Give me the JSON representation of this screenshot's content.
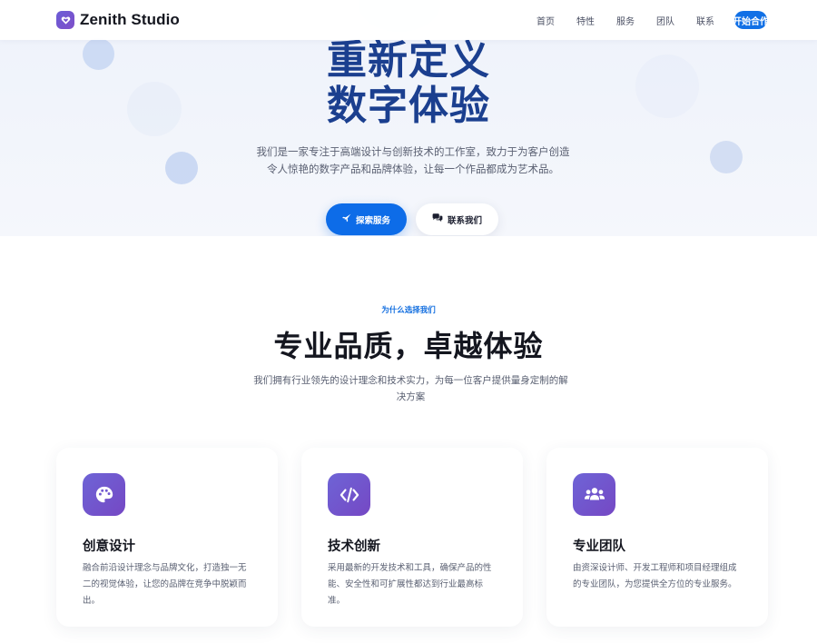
{
  "nav": {
    "brand": "Zenith Studio",
    "links": [
      "首页",
      "特性",
      "服务",
      "团队",
      "联系"
    ],
    "cta": "开始合作"
  },
  "hero": {
    "title_line1": "重新定义",
    "title_line2": "数字体验",
    "description_line1": "我们是一家专注于高端设计与创新技术的工作室，致力于为客户创造",
    "description_line2": "令人惊艳的数字产品和品牌体验，让每一个作品都成为艺术品。",
    "primary_button": "探索服务",
    "secondary_button": "联系我们"
  },
  "features": {
    "eyebrow": "为什么选择我们",
    "title": "专业品质，卓越体验",
    "description_line1": "我们拥有行业领先的设计理念和技术实力，为每一位客户提供量身定制的解",
    "description_line2": "决方案",
    "cards": [
      {
        "icon": "palette-icon",
        "title": "创意设计",
        "desc_lines": [
          "融合前沿设计理念与品牌文化，打造独一无",
          "二的视觉体验，让您的品牌在竞争中脱颖而",
          "出。"
        ]
      },
      {
        "icon": "code-icon",
        "title": "技术创新",
        "desc_lines": [
          "采用最新的开发技术和工具，确保产品的性",
          "能、安全性和可扩展性都达到行业最高标",
          "准。"
        ]
      },
      {
        "icon": "users-icon",
        "title": "专业团队",
        "desc_lines": [
          "由资深设计师、开发工程师和项目经理组成",
          "的专业团队，为您提供全方位的专业服务。"
        ]
      }
    ]
  },
  "colors": {
    "accent": "#0d6ce8",
    "hero_title": "#1b3f8f",
    "icon_gradient_start": "#6e64d6",
    "icon_gradient_end": "#7548c4"
  }
}
